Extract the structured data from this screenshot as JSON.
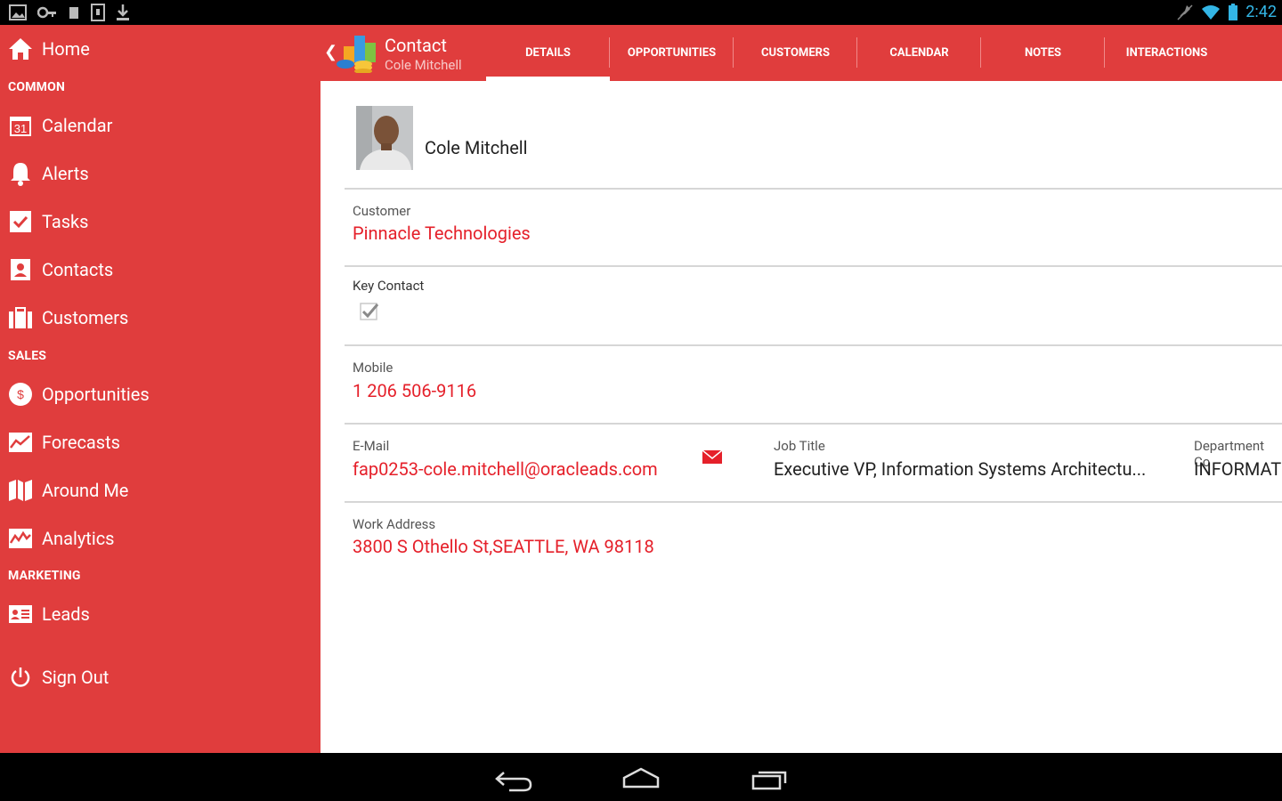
{
  "status_bar": {
    "time": "2:42",
    "left_icons": [
      "gallery-icon",
      "key-icon",
      "sim-icon",
      "screenshot-icon",
      "download-icon"
    ],
    "right_icons": [
      "mute-icon",
      "wifi-icon",
      "battery-icon"
    ]
  },
  "sidebar": {
    "home": "Home",
    "sections": [
      {
        "header": "COMMON"
      },
      {
        "header": "SALES"
      },
      {
        "header": "MARKETING"
      }
    ],
    "items": [
      {
        "label": "Calendar",
        "icon": "calendar-icon"
      },
      {
        "label": "Alerts",
        "icon": "bell-icon"
      },
      {
        "label": "Tasks",
        "icon": "checkbox-icon"
      },
      {
        "label": "Contacts",
        "icon": "contact-book-icon"
      },
      {
        "label": "Customers",
        "icon": "briefcase-icon"
      },
      {
        "label": "Opportunities",
        "icon": "dollar-icon"
      },
      {
        "label": "Forecasts",
        "icon": "trend-icon"
      },
      {
        "label": "Around Me",
        "icon": "map-icon"
      },
      {
        "label": "Analytics",
        "icon": "analytics-icon"
      },
      {
        "label": "Leads",
        "icon": "id-card-icon"
      }
    ],
    "sign_out": "Sign Out",
    "calendar_day": "31"
  },
  "header": {
    "title": "Contact",
    "subtitle": "Cole Mitchell",
    "tabs": [
      {
        "label": "DETAILS",
        "active": true
      },
      {
        "label": "OPPORTUNITIES"
      },
      {
        "label": "CUSTOMERS"
      },
      {
        "label": "CALENDAR"
      },
      {
        "label": "NOTES"
      },
      {
        "label": "INTERACTIONS"
      }
    ]
  },
  "contact": {
    "name": "Cole Mitchell",
    "customer_label": "Customer",
    "customer": "Pinnacle Technologies",
    "key_contact_label": "Key Contact",
    "key_contact_checked": true,
    "mobile_label": "Mobile",
    "mobile": "1 206 506-9116",
    "email_label": "E-Mail",
    "email": "fap0253-cole.mitchell@oracleads.com",
    "job_title_label": "Job Title",
    "job_title": "Executive VP, Information Systems Architectu...",
    "department_label": "Department Co",
    "department": "INFORMAT",
    "work_address_label": "Work Address",
    "work_address": "3800 S Othello St,SEATTLE, WA  98118"
  },
  "colors": {
    "brand_red": "#e03d3d",
    "link_red": "#e5202a",
    "status_blue": "#33b5e5"
  }
}
